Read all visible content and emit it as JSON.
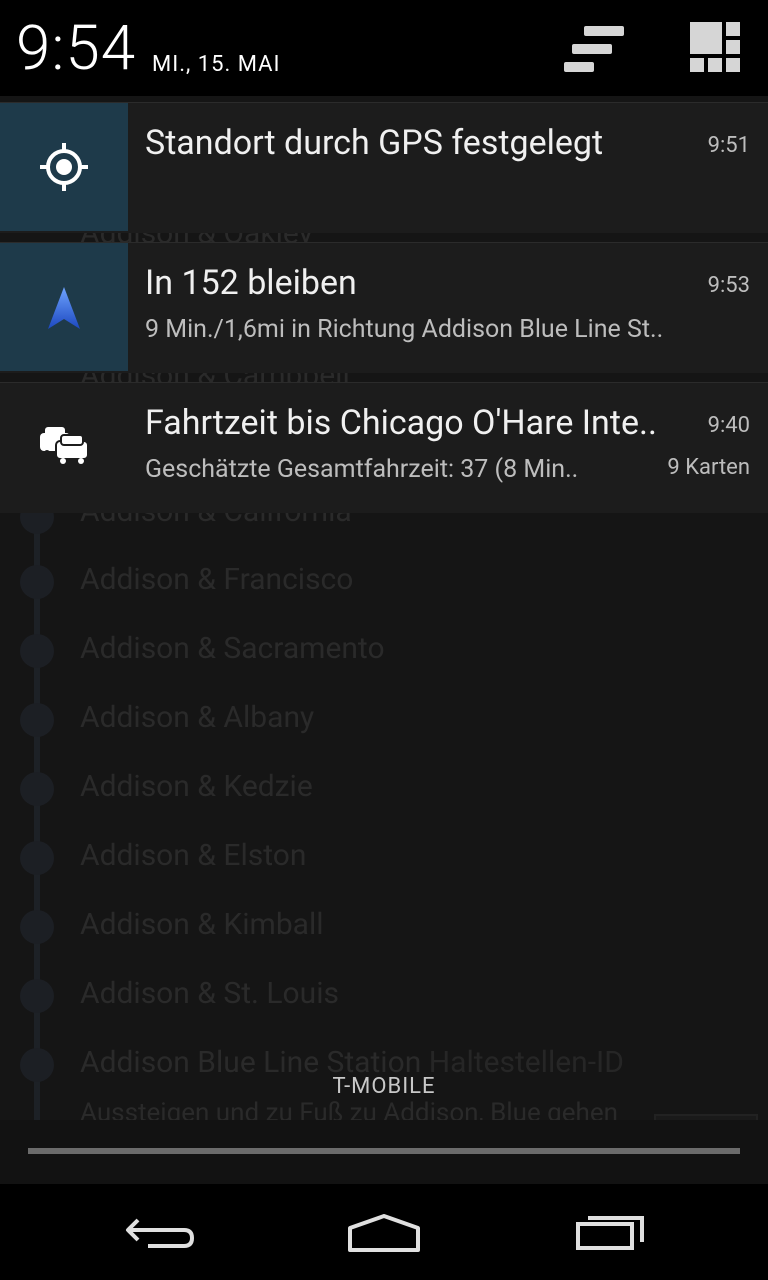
{
  "status_bar": {
    "time": "9:54",
    "date": "MI., 15. MAI"
  },
  "background": {
    "stops": [
      "Addison & Oakley",
      "Addison & Campbell",
      "Addison & California",
      "Addison & Francisco",
      "Addison & Sacramento",
      "Addison & Albany",
      "Addison & Kedzie",
      "Addison & Elston",
      "Addison & Kimball",
      "Addison & St. Louis",
      "Addison Blue Line Station"
    ],
    "last_stop_suffix": "Haltestellen-ID",
    "footer_text": "Aussteigen und zu Fuß zu Addison, Blue gehen"
  },
  "notifications": [
    {
      "title": "Standort durch GPS festgelegt",
      "time": "9:51",
      "icon": "gps-icon"
    },
    {
      "title": "In 152 bleiben",
      "time": "9:53",
      "subtitle": "9 Min./1,6mi in Richtung Addison Blue Line St..",
      "icon": "navigation-arrow-icon"
    },
    {
      "title": "Fahrtzeit bis Chicago O'Hare Inte..",
      "time": "9:40",
      "subtitle": "Geschätzte Gesamtfahrzeit: 37 (8 Min..",
      "info": "9 Karten",
      "icon": "traffic-cars-icon"
    }
  ],
  "carrier": "T-MOBILE",
  "colors": {
    "accent_blue": "#2f6bd0",
    "icon_box": "#1e3a4a"
  }
}
